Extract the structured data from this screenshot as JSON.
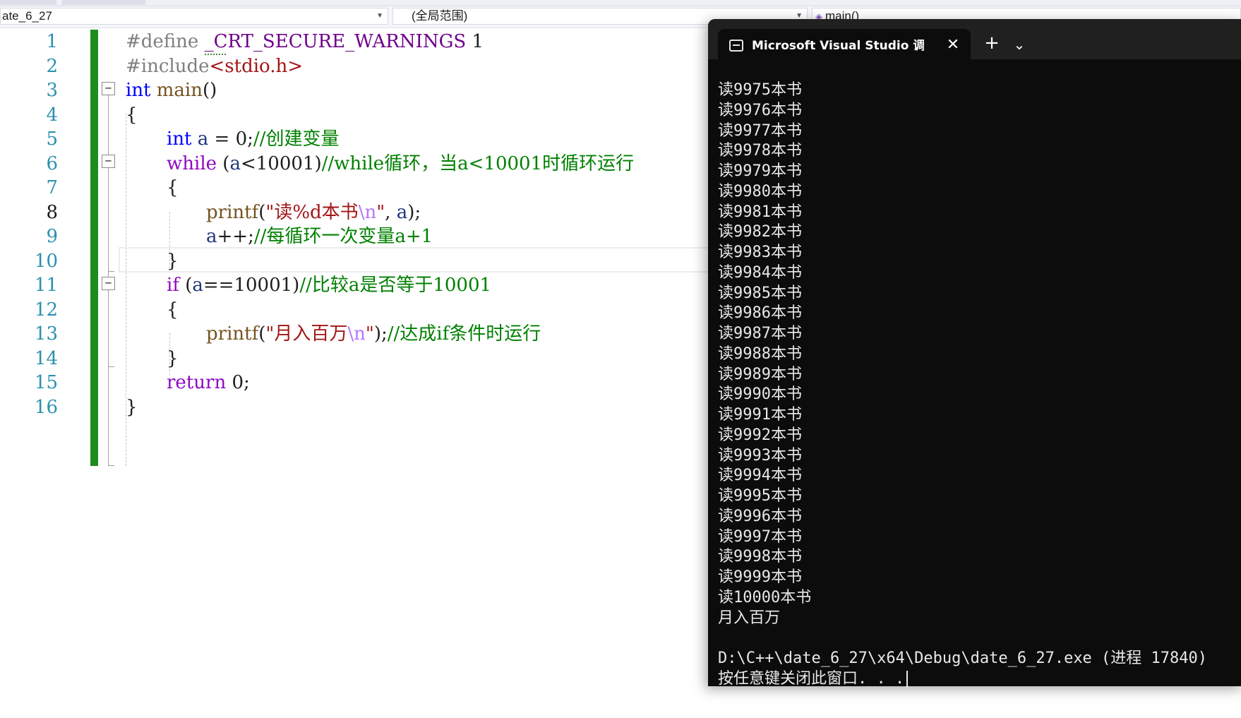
{
  "nav": {
    "file_combo": "ate_6_27",
    "scope_combo": "(全局范围)",
    "member_combo": "main()"
  },
  "editor": {
    "lines": [
      {
        "num": "1",
        "tokens": [
          {
            "t": "#define ",
            "c": "pp"
          },
          {
            "t": "_CRT_SECURE_WARNINGS",
            "c": "mac"
          },
          {
            "t": " 1",
            "c": ""
          }
        ]
      },
      {
        "num": "2",
        "tokens": [
          {
            "t": "#include",
            "c": "pp"
          },
          {
            "t": "<stdio.h>",
            "c": "str"
          }
        ]
      },
      {
        "num": "3",
        "tokens": [
          {
            "t": "int",
            "c": "kw"
          },
          {
            "t": " ",
            "c": ""
          },
          {
            "t": "main",
            "c": "fn"
          },
          {
            "t": "()",
            "c": ""
          }
        ]
      },
      {
        "num": "4",
        "tokens": [
          {
            "t": "{",
            "c": ""
          }
        ]
      },
      {
        "num": "5",
        "tokens": [
          {
            "t": "int",
            "c": "kw"
          },
          {
            "t": " ",
            "c": ""
          },
          {
            "t": "a",
            "c": "var"
          },
          {
            "t": " = 0;",
            "c": ""
          },
          {
            "t": "//创建变量",
            "c": "cmt"
          }
        ]
      },
      {
        "num": "6",
        "tokens": [
          {
            "t": "while",
            "c": "ctl"
          },
          {
            "t": " (",
            "c": ""
          },
          {
            "t": "a",
            "c": "var"
          },
          {
            "t": "<10001)",
            "c": ""
          },
          {
            "t": "//while循环，当a<10001时循环运行",
            "c": "cmt"
          }
        ]
      },
      {
        "num": "7",
        "tokens": [
          {
            "t": "{",
            "c": ""
          }
        ]
      },
      {
        "num": "8",
        "tokens": [
          {
            "t": "printf",
            "c": "fn"
          },
          {
            "t": "(",
            "c": ""
          },
          {
            "t": "\"读%d本书",
            "c": "str"
          },
          {
            "t": "\\n",
            "c": "esc"
          },
          {
            "t": "\"",
            "c": "str"
          },
          {
            "t": ", ",
            "c": ""
          },
          {
            "t": "a",
            "c": "var"
          },
          {
            "t": ");",
            "c": ""
          }
        ]
      },
      {
        "num": "9",
        "tokens": [
          {
            "t": "a",
            "c": "var"
          },
          {
            "t": "++;",
            "c": ""
          },
          {
            "t": "//每循环一次变量a+1",
            "c": "cmt"
          }
        ]
      },
      {
        "num": "10",
        "tokens": [
          {
            "t": "}",
            "c": ""
          }
        ]
      },
      {
        "num": "11",
        "tokens": [
          {
            "t": "if",
            "c": "ctl"
          },
          {
            "t": " (",
            "c": ""
          },
          {
            "t": "a",
            "c": "var"
          },
          {
            "t": "==10001)",
            "c": ""
          },
          {
            "t": "//比较a是否等于10001",
            "c": "cmt"
          }
        ]
      },
      {
        "num": "12",
        "tokens": [
          {
            "t": "{",
            "c": ""
          }
        ]
      },
      {
        "num": "13",
        "tokens": [
          {
            "t": "printf",
            "c": "fn"
          },
          {
            "t": "(",
            "c": ""
          },
          {
            "t": "\"月入百万",
            "c": "str"
          },
          {
            "t": "\\n",
            "c": "esc"
          },
          {
            "t": "\"",
            "c": "str"
          },
          {
            "t": ");",
            "c": ""
          },
          {
            "t": "//达成if条件时运行",
            "c": "cmt"
          }
        ]
      },
      {
        "num": "14",
        "tokens": [
          {
            "t": "}",
            "c": ""
          }
        ]
      },
      {
        "num": "15",
        "tokens": [
          {
            "t": "return",
            "c": "ctl"
          },
          {
            "t": " 0;",
            "c": ""
          }
        ]
      },
      {
        "num": "16",
        "tokens": [
          {
            "t": "}",
            "c": ""
          }
        ]
      }
    ],
    "current_line": "8"
  },
  "console": {
    "tab_title": "Microsoft Visual Studio 调试控制台",
    "close_glyph": "✕",
    "new_tab_glyph": "+",
    "dropdown_glyph": "⌄",
    "output_lines": [
      "读9975本书",
      "读9976本书",
      "读9977本书",
      "读9978本书",
      "读9979本书",
      "读9980本书",
      "读9981本书",
      "读9982本书",
      "读9983本书",
      "读9984本书",
      "读9985本书",
      "读9986本书",
      "读9987本书",
      "读9988本书",
      "读9989本书",
      "读9990本书",
      "读9991本书",
      "读9992本书",
      "读9993本书",
      "读9994本书",
      "读9995本书",
      "读9996本书",
      "读9997本书",
      "读9998本书",
      "读9999本书",
      "读10000本书",
      "月入百万",
      "",
      "D:\\C++\\date_6_27\\x64\\Debug\\date_6_27.exe (进程 17840)",
      "按任意键关闭此窗口. . ."
    ]
  }
}
